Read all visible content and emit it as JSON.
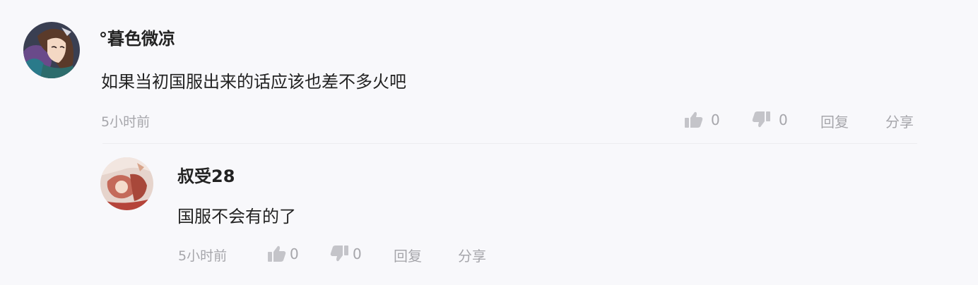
{
  "comment": {
    "username": "°暮色微凉",
    "text": "如果当初国服出来的话应该也差不多火吧",
    "time": "5小时前",
    "like_count": "0",
    "dislike_count": "0",
    "reply_label": "回复",
    "share_label": "分享"
  },
  "reply": {
    "username": "叔受28",
    "text": "国服不会有的了",
    "time": "5小时前",
    "like_count": "0",
    "dislike_count": "0",
    "reply_label": "回复",
    "share_label": "分享"
  },
  "icons": {
    "like": "thumbs-up-icon",
    "dislike": "thumbs-down-icon"
  },
  "colors": {
    "background": "#f8f8fb",
    "text_primary": "#222222",
    "text_meta": "#a6a6ab",
    "icon": "#c4c4c9"
  }
}
